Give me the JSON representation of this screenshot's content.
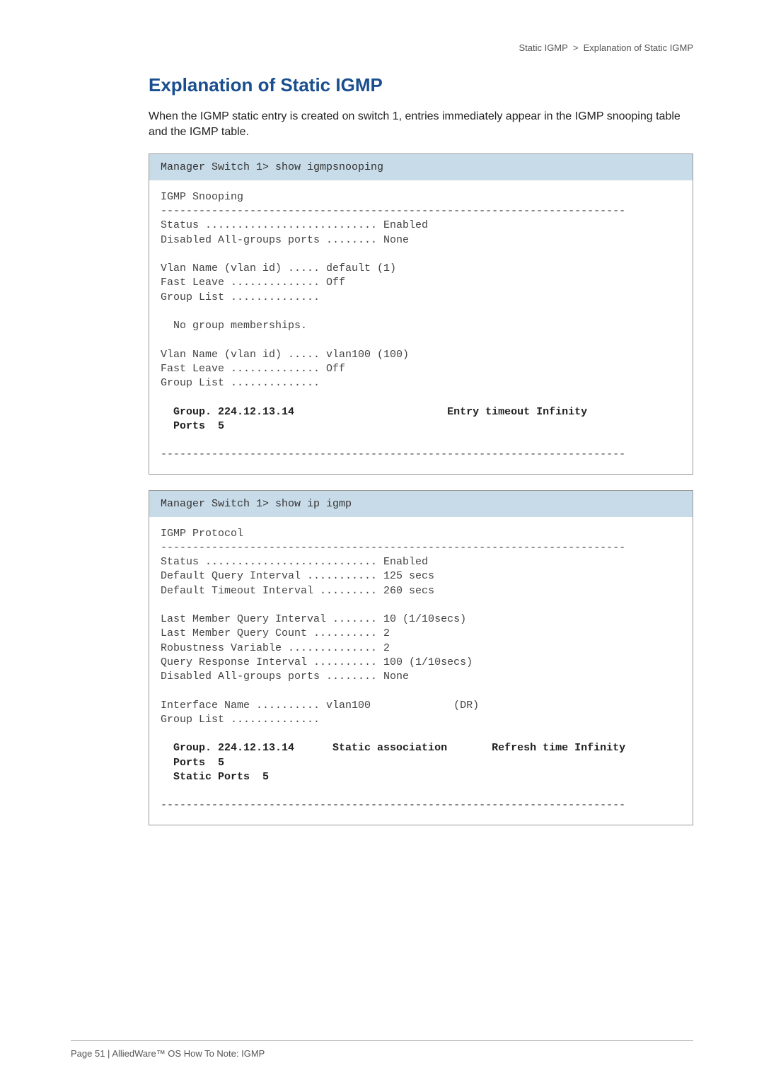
{
  "breadcrumb": {
    "section": "Static IGMP",
    "separator": ">",
    "page": "Explanation of Static IGMP"
  },
  "title": "Explanation of Static IGMP",
  "intro": "When the IGMP static entry is created on switch 1, entries immediately appear in the IGMP snooping table and the IGMP table.",
  "block1": {
    "cmd": "Manager Switch 1> show igmpsnooping",
    "line_title": "IGMP Snooping",
    "hr": "-------------------------------------------------------------------------",
    "status": "Status ........................... Enabled",
    "disabled_ports": "Disabled All-groups ports ........ None",
    "vlan1_name": "Vlan Name (vlan id) ..... default (1)",
    "vlan1_fastleave": "Fast Leave .............. Off",
    "vlan1_grouplist": "Group List ..............",
    "vlan1_msg": "  No group memberships.",
    "vlan2_name": "Vlan Name (vlan id) ..... vlan100 (100)",
    "vlan2_fastleave": "Fast Leave .............. Off",
    "vlan2_grouplist": "Group List ..............",
    "bold_group": "  Group. 224.12.13.14                        Entry timeout Infinity",
    "bold_ports": "  Ports  5"
  },
  "block2": {
    "cmd": "Manager Switch 1> show ip igmp",
    "line_title": "IGMP Protocol",
    "hr": "-------------------------------------------------------------------------",
    "status": "Status ........................... Enabled",
    "dqi": "Default Query Interval ........... 125 secs",
    "dti": "Default Timeout Interval ......... 260 secs",
    "lmqi": "Last Member Query Interval ....... 10 (1/10secs)",
    "lmqc": "Last Member Query Count .......... 2",
    "rv": "Robustness Variable .............. 2",
    "qri": "Query Response Interval .......... 100 (1/10secs)",
    "dap": "Disabled All-groups ports ........ None",
    "ifname": "Interface Name .......... vlan100             (DR)",
    "grouplist": "Group List ..............",
    "bold_group": "  Group. 224.12.13.14      Static association       Refresh time Infinity",
    "bold_ports": "  Ports  5",
    "bold_static": "  Static Ports  5"
  },
  "footer": "Page 51 | AlliedWare™ OS How To Note: IGMP"
}
